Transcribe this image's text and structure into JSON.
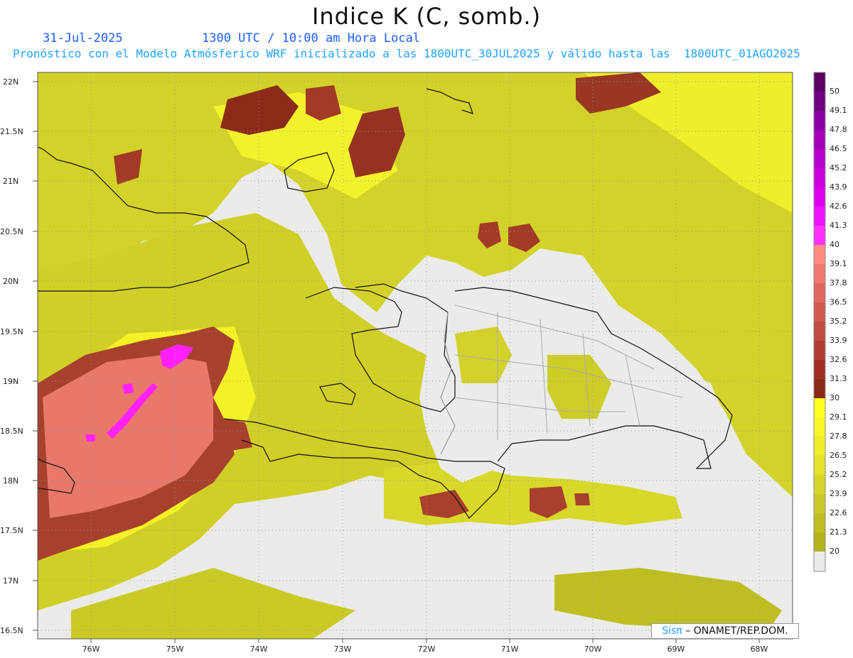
{
  "header": {
    "title": "Indice K (C, somb.)",
    "date": "31-Jul-2025",
    "time": "1300 UTC / 10:00 am Hora Local",
    "description": "Pronóstico con el Modelo Atmósferico WRF inicializado a las 1800UTC_30JUL2025 y válido hasta las  1800UTC_01AGO2025"
  },
  "axes": {
    "lat_labels": [
      "22N",
      "21.5N",
      "21N",
      "20.5N",
      "20N",
      "19.5N",
      "19N",
      "18.5N",
      "18N",
      "17.5N",
      "17N",
      "16.5N"
    ],
    "lon_labels": [
      "76W",
      "75W",
      "74W",
      "73W",
      "72W",
      "71W",
      "70W",
      "69W",
      "68W"
    ]
  },
  "legend": {
    "levels": [
      "50",
      "49.1",
      "47.8",
      "46.5",
      "45.2",
      "43.9",
      "42.6",
      "41.3",
      "40",
      "39.1",
      "37.8",
      "36.5",
      "35.2",
      "33.9",
      "32.6",
      "31.3",
      "30",
      "29.1",
      "27.8",
      "26.5",
      "25.2",
      "23.9",
      "22.6",
      "21.3",
      "20"
    ],
    "colors": [
      "#5a0060",
      "#6e0080",
      "#8a00a0",
      "#a400b8",
      "#b800cc",
      "#cc00dd",
      "#dd00ee",
      "#ee10ff",
      "#ff30ff",
      "#ff8a80",
      "#f07a70",
      "#e06860",
      "#d05a50",
      "#c04c42",
      "#b03e34",
      "#a03026",
      "#8a2a14",
      "#ffff20",
      "#f8f528",
      "#eeee2a",
      "#e2e22a",
      "#d6d62a",
      "#caca28",
      "#bebe22",
      "#b4b41c"
    ],
    "below_color": "#ebebeb"
  },
  "credit": {
    "logo": "Sisπ",
    "org": "– ONAMET/REP.DOM."
  }
}
